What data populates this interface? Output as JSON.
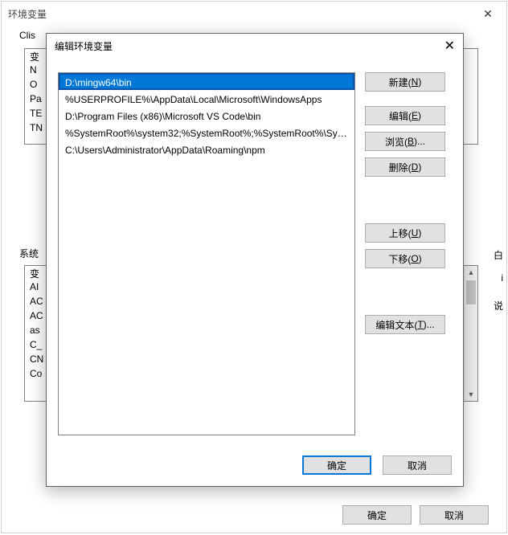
{
  "outer": {
    "title": "环境变量",
    "user_section_label": "Clis",
    "sys_section_label": "系统",
    "user_rows": [
      "变",
      "N",
      "O",
      "Pa",
      "TE",
      "TN"
    ],
    "sys_rows": [
      "变",
      "AI",
      "AC",
      "AC",
      "as",
      "C_",
      "CN",
      "Co"
    ],
    "ok": "确定",
    "cancel": "取消"
  },
  "inner": {
    "title": "编辑环境变量",
    "paths": [
      "D:\\mingw64\\bin",
      "%USERPROFILE%\\AppData\\Local\\Microsoft\\WindowsApps",
      "D:\\Program Files (x86)\\Microsoft VS Code\\bin",
      "%SystemRoot%\\system32;%SystemRoot%;%SystemRoot%\\Syst...",
      "C:\\Users\\Administrator\\AppData\\Roaming\\npm"
    ],
    "selected_index": 0,
    "buttons": {
      "new_": "新建(",
      "new_m": "N",
      "new_rp": ")",
      "edit": "编辑(",
      "edit_m": "E",
      "edit_rp": ")",
      "browse": "浏览(",
      "browse_m": "B",
      "browse_rp": ")...",
      "delete_": "删除(",
      "delete_m": "D",
      "delete_rp": ")",
      "moveup": "上移(",
      "moveup_m": "U",
      "moveup_rp": ")",
      "movedown": "下移(",
      "movedown_m": "O",
      "movedown_rp": ")",
      "edittext": "编辑文本(",
      "edittext_m": "T",
      "edittext_rp": ")..."
    },
    "ok": "确定",
    "cancel": "取消"
  },
  "edge": {
    "a": "白",
    "b": "i",
    "c": "说"
  }
}
